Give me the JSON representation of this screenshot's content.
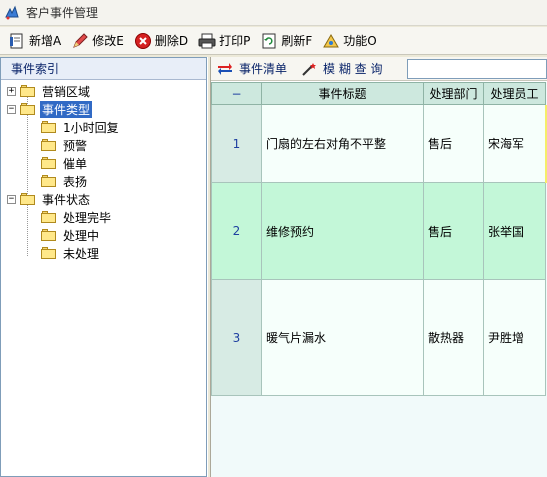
{
  "window": {
    "title": "客户事件管理",
    "icon": "app-icon"
  },
  "toolbar": {
    "buttons": [
      {
        "label": "新增A",
        "icon": "new-doc-icon"
      },
      {
        "label": "修改E",
        "icon": "edit-icon"
      },
      {
        "label": "删除D",
        "icon": "delete-icon"
      },
      {
        "label": "打印P",
        "icon": "printer-icon"
      },
      {
        "label": "刷新F",
        "icon": "refresh-icon"
      },
      {
        "label": "功能O",
        "icon": "function-icon"
      }
    ]
  },
  "left_panel": {
    "header": "事件索引",
    "tree": [
      {
        "label": "营销区域",
        "expander": "+",
        "level": 0
      },
      {
        "label": "事件类型",
        "expander": "−",
        "level": 0,
        "selected": true
      },
      {
        "label": "1小时回复",
        "level": 1
      },
      {
        "label": "预警",
        "level": 1
      },
      {
        "label": "催单",
        "level": 1
      },
      {
        "label": "表扬",
        "level": 1
      },
      {
        "label": "事件状态",
        "expander": "−",
        "level": 0
      },
      {
        "label": "处理完毕",
        "level": 1
      },
      {
        "label": "处理中",
        "level": 1
      },
      {
        "label": "未处理",
        "level": 1
      }
    ]
  },
  "right_panel": {
    "tabs": [
      {
        "label": "事件清单",
        "icon": "swap-arrows-icon"
      },
      {
        "label": "模 糊 查 询",
        "icon": "magic-wand-icon"
      }
    ],
    "search": {
      "value": "",
      "placeholder": ""
    },
    "table": {
      "corner": "−",
      "columns": [
        "事件标题",
        "处理部门",
        "处理员工"
      ],
      "rows": [
        {
          "no": "1",
          "title": "门扇的左右对角不平整",
          "dept": "售后",
          "staff": "宋海军"
        },
        {
          "no": "2",
          "title": "维修预约",
          "dept": "售后",
          "staff": "张举国"
        },
        {
          "no": "3",
          "title": "暖气片漏水",
          "dept": "散热器",
          "staff": "尹胜增"
        }
      ]
    }
  },
  "colors": {
    "selection": "#316ac5",
    "header_bg": "#cde8de",
    "row_highlight": "#c3f7d8",
    "grid_bg": "#f1fafa"
  }
}
